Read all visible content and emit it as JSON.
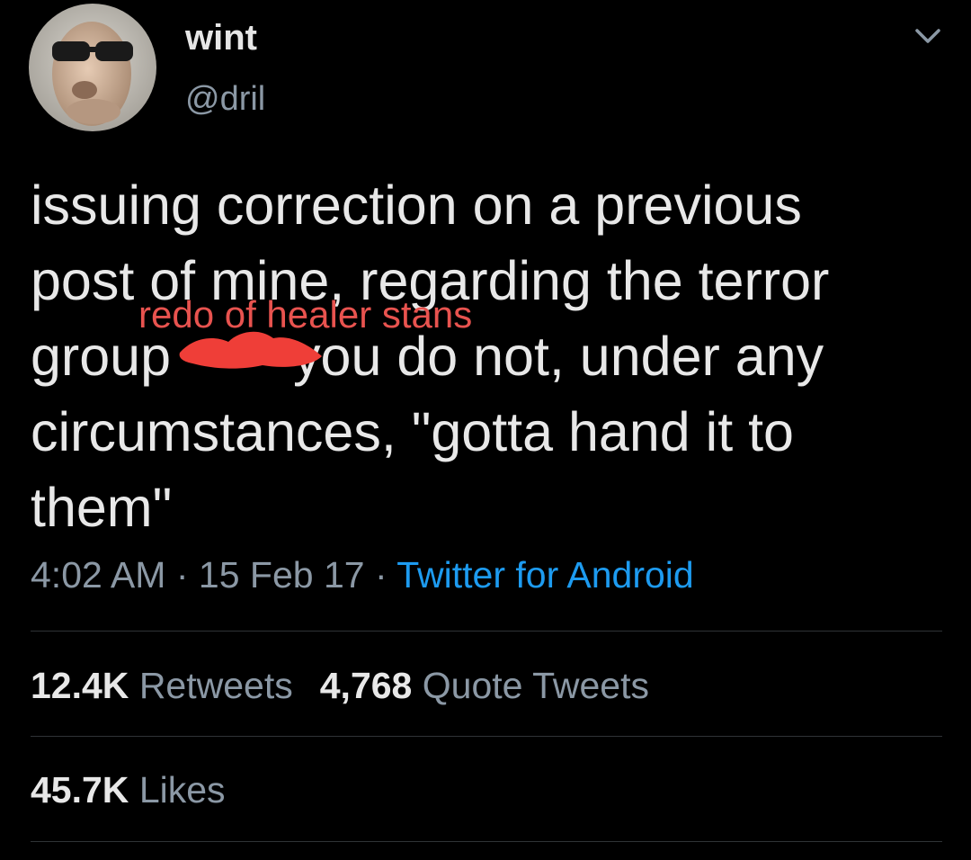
{
  "user": {
    "display_name": "wint",
    "handle": "@dril",
    "avatar_icon": "profile-photo"
  },
  "tweet": {
    "lines": [
      "issuing correction on a previous",
      "post of mine, regarding the terror",
      "you do not, under any",
      "circumstances, \"gotta hand it to",
      "them\""
    ],
    "line3_prefix": "group",
    "overlay_text": "redo of healer stans",
    "overlay_color": "#e8534f",
    "redaction_color": "#ef3e38"
  },
  "meta": {
    "time": "4:02 AM",
    "separator": "·",
    "date": "15 Feb 17",
    "source": "Twitter for Android",
    "source_color": "#1d9bf0"
  },
  "stats": {
    "retweets_count": "12.4K",
    "retweets_label": "Retweets",
    "quotes_count": "4,768",
    "quotes_label": "Quote Tweets",
    "likes_count": "45.7K",
    "likes_label": "Likes"
  },
  "icons": {
    "menu": "chevron-down-icon"
  }
}
